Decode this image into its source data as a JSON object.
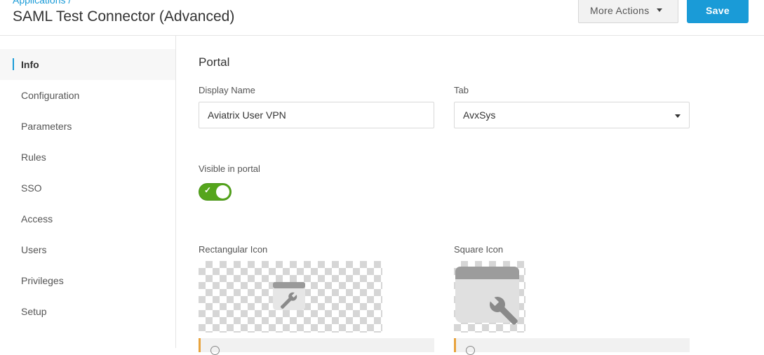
{
  "header": {
    "breadcrumb": "Applications /",
    "title": "SAML Test Connector (Advanced)",
    "more_actions_label": "More Actions",
    "save_label": "Save"
  },
  "sidebar": {
    "items": [
      {
        "label": "Info",
        "active": true
      },
      {
        "label": "Configuration",
        "active": false
      },
      {
        "label": "Parameters",
        "active": false
      },
      {
        "label": "Rules",
        "active": false
      },
      {
        "label": "SSO",
        "active": false
      },
      {
        "label": "Access",
        "active": false
      },
      {
        "label": "Users",
        "active": false
      },
      {
        "label": "Privileges",
        "active": false
      },
      {
        "label": "Setup",
        "active": false
      }
    ]
  },
  "portal": {
    "section_title": "Portal",
    "display_name_label": "Display Name",
    "display_name_value": "Aviatrix User VPN",
    "tab_label": "Tab",
    "tab_value": "AvxSys",
    "visible_label": "Visible in portal",
    "visible_enabled": true,
    "rect_icon_label": "Rectangular Icon",
    "square_icon_label": "Square Icon"
  },
  "colors": {
    "accent": "#1a9bd7",
    "toggle_on": "#55a51c",
    "notice_border": "#e8a33d"
  },
  "icons": {
    "toggle_check": "check-icon",
    "app_placeholder": "wrench-icon",
    "dropdown": "caret-down-icon"
  }
}
